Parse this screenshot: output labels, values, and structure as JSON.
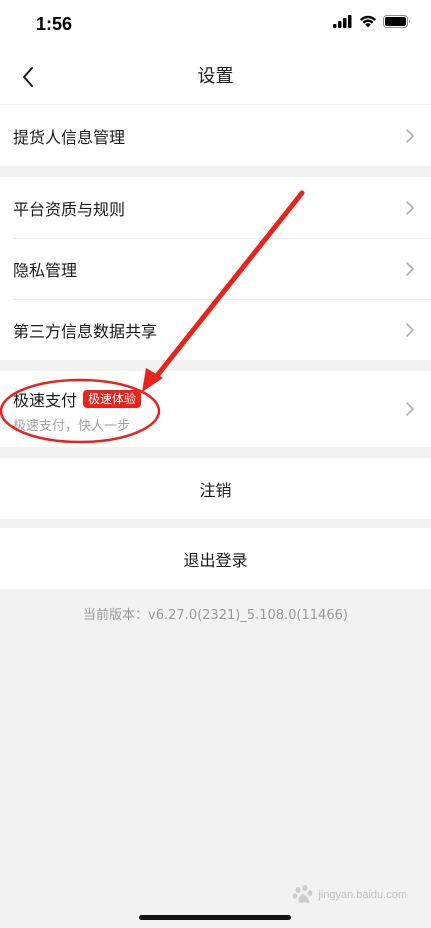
{
  "status_bar": {
    "time": "1:56"
  },
  "header": {
    "title": "设置"
  },
  "groups": {
    "pickup": {
      "item_label": "提货人信息管理"
    },
    "info": {
      "items": [
        {
          "label": "平台资质与规则"
        },
        {
          "label": "隐私管理"
        },
        {
          "label": "第三方信息数据共享"
        }
      ]
    },
    "fast_pay": {
      "title": "极速支付",
      "badge": "极速体验",
      "subtitle": "极速支付，快人一步"
    },
    "cancel": {
      "label": "注销"
    },
    "logout": {
      "label": "退出登录"
    }
  },
  "footer": {
    "version": "当前版本：v6.27.0(2321)_5.108.0(11466)"
  },
  "watermark": {
    "text": "jingyan.baidu.com"
  },
  "colors": {
    "accent_red": "#e8231c",
    "background": "#f2f2f2",
    "row_bg": "#ffffff"
  }
}
